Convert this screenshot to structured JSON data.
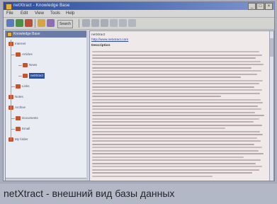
{
  "window": {
    "title": "netXtract - Knowledge Base"
  },
  "menubar": {
    "items": [
      "File",
      "Edit",
      "View",
      "Tools",
      "Help"
    ]
  },
  "toolbar": {
    "search_label": "Search"
  },
  "tree": {
    "root_label": "Knowledge Base",
    "items": [
      {
        "label": "Internet",
        "level": 1,
        "icon_color": "#c2552e"
      },
      {
        "label": "Articles",
        "level": 2,
        "icon_color": "#c2552e"
      },
      {
        "label": "News",
        "level": 3,
        "icon_color": "#c2552e"
      },
      {
        "label": "netXtract",
        "level": 3,
        "icon_color": "#c2552e",
        "selected": true
      },
      {
        "label": "Links",
        "level": 2,
        "icon_color": "#c2552e"
      },
      {
        "label": "Notes",
        "level": 1,
        "icon_color": "#c2552e"
      },
      {
        "label": "Archive",
        "level": 1,
        "icon_color": "#c2552e"
      },
      {
        "label": "Documents",
        "level": 2,
        "icon_color": "#c2552e"
      },
      {
        "label": "Email",
        "level": 2,
        "icon_color": "#c2552e"
      },
      {
        "label": "My folder",
        "level": 1,
        "icon_color": "#c2552e"
      }
    ]
  },
  "content": {
    "title": "netXtract",
    "url": "http://www.netxtract.com",
    "heading": "Description"
  },
  "caption": {
    "text": "netXtract - внешний вид базы данных"
  },
  "colors": {
    "selection": "#2c4fa0",
    "titlebar": "#2b4d9e",
    "caption_bg": "#b3b8c7"
  }
}
